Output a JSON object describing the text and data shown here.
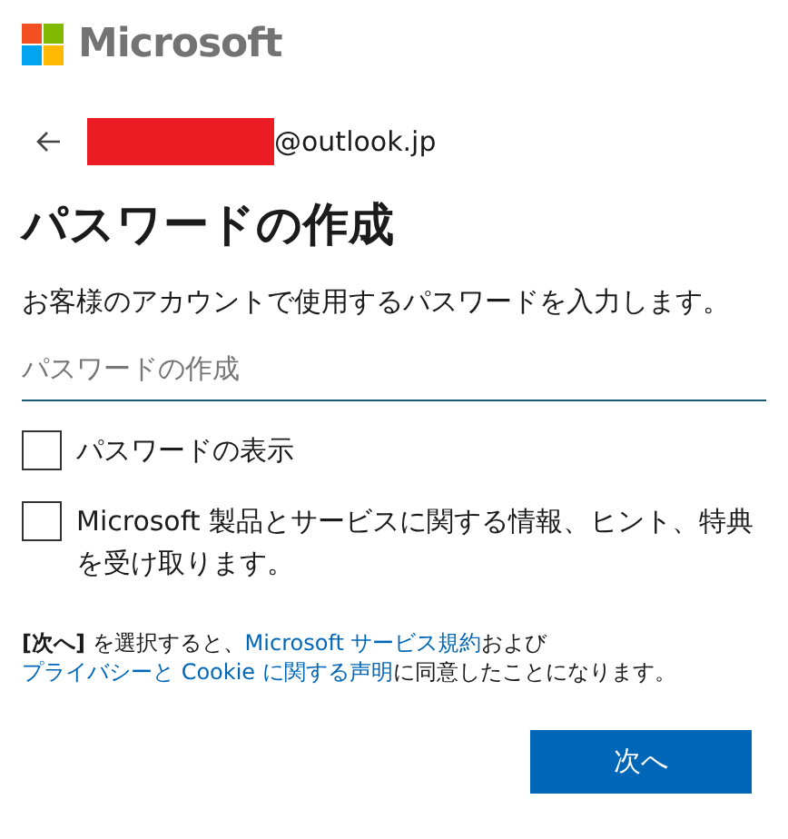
{
  "logo": {
    "text": "Microsoft"
  },
  "account": {
    "email_suffix": "@outlook.jp"
  },
  "title": "パスワードの作成",
  "description": "お客様のアカウントで使用するパスワードを入力します。",
  "password_field": {
    "placeholder": "パスワードの作成"
  },
  "options": [
    {
      "label": "パスワードの表示",
      "checked": false
    },
    {
      "label": "Microsoft 製品とサービスに関する情報、ヒント、特典を受け取ります。",
      "checked": false
    }
  ],
  "legal": [
    {
      "kind": "text",
      "text": "**[次へ]** を選択すると、"
    },
    {
      "kind": "link",
      "text": "Microsoft サービス規約"
    },
    {
      "kind": "text",
      "text": "および"
    },
    {
      "kind": "link",
      "text": "プライバシーと Cookie に関する声明"
    },
    {
      "kind": "text",
      "text": "に同意したことになります。"
    }
  ],
  "next_button": "次へ"
}
